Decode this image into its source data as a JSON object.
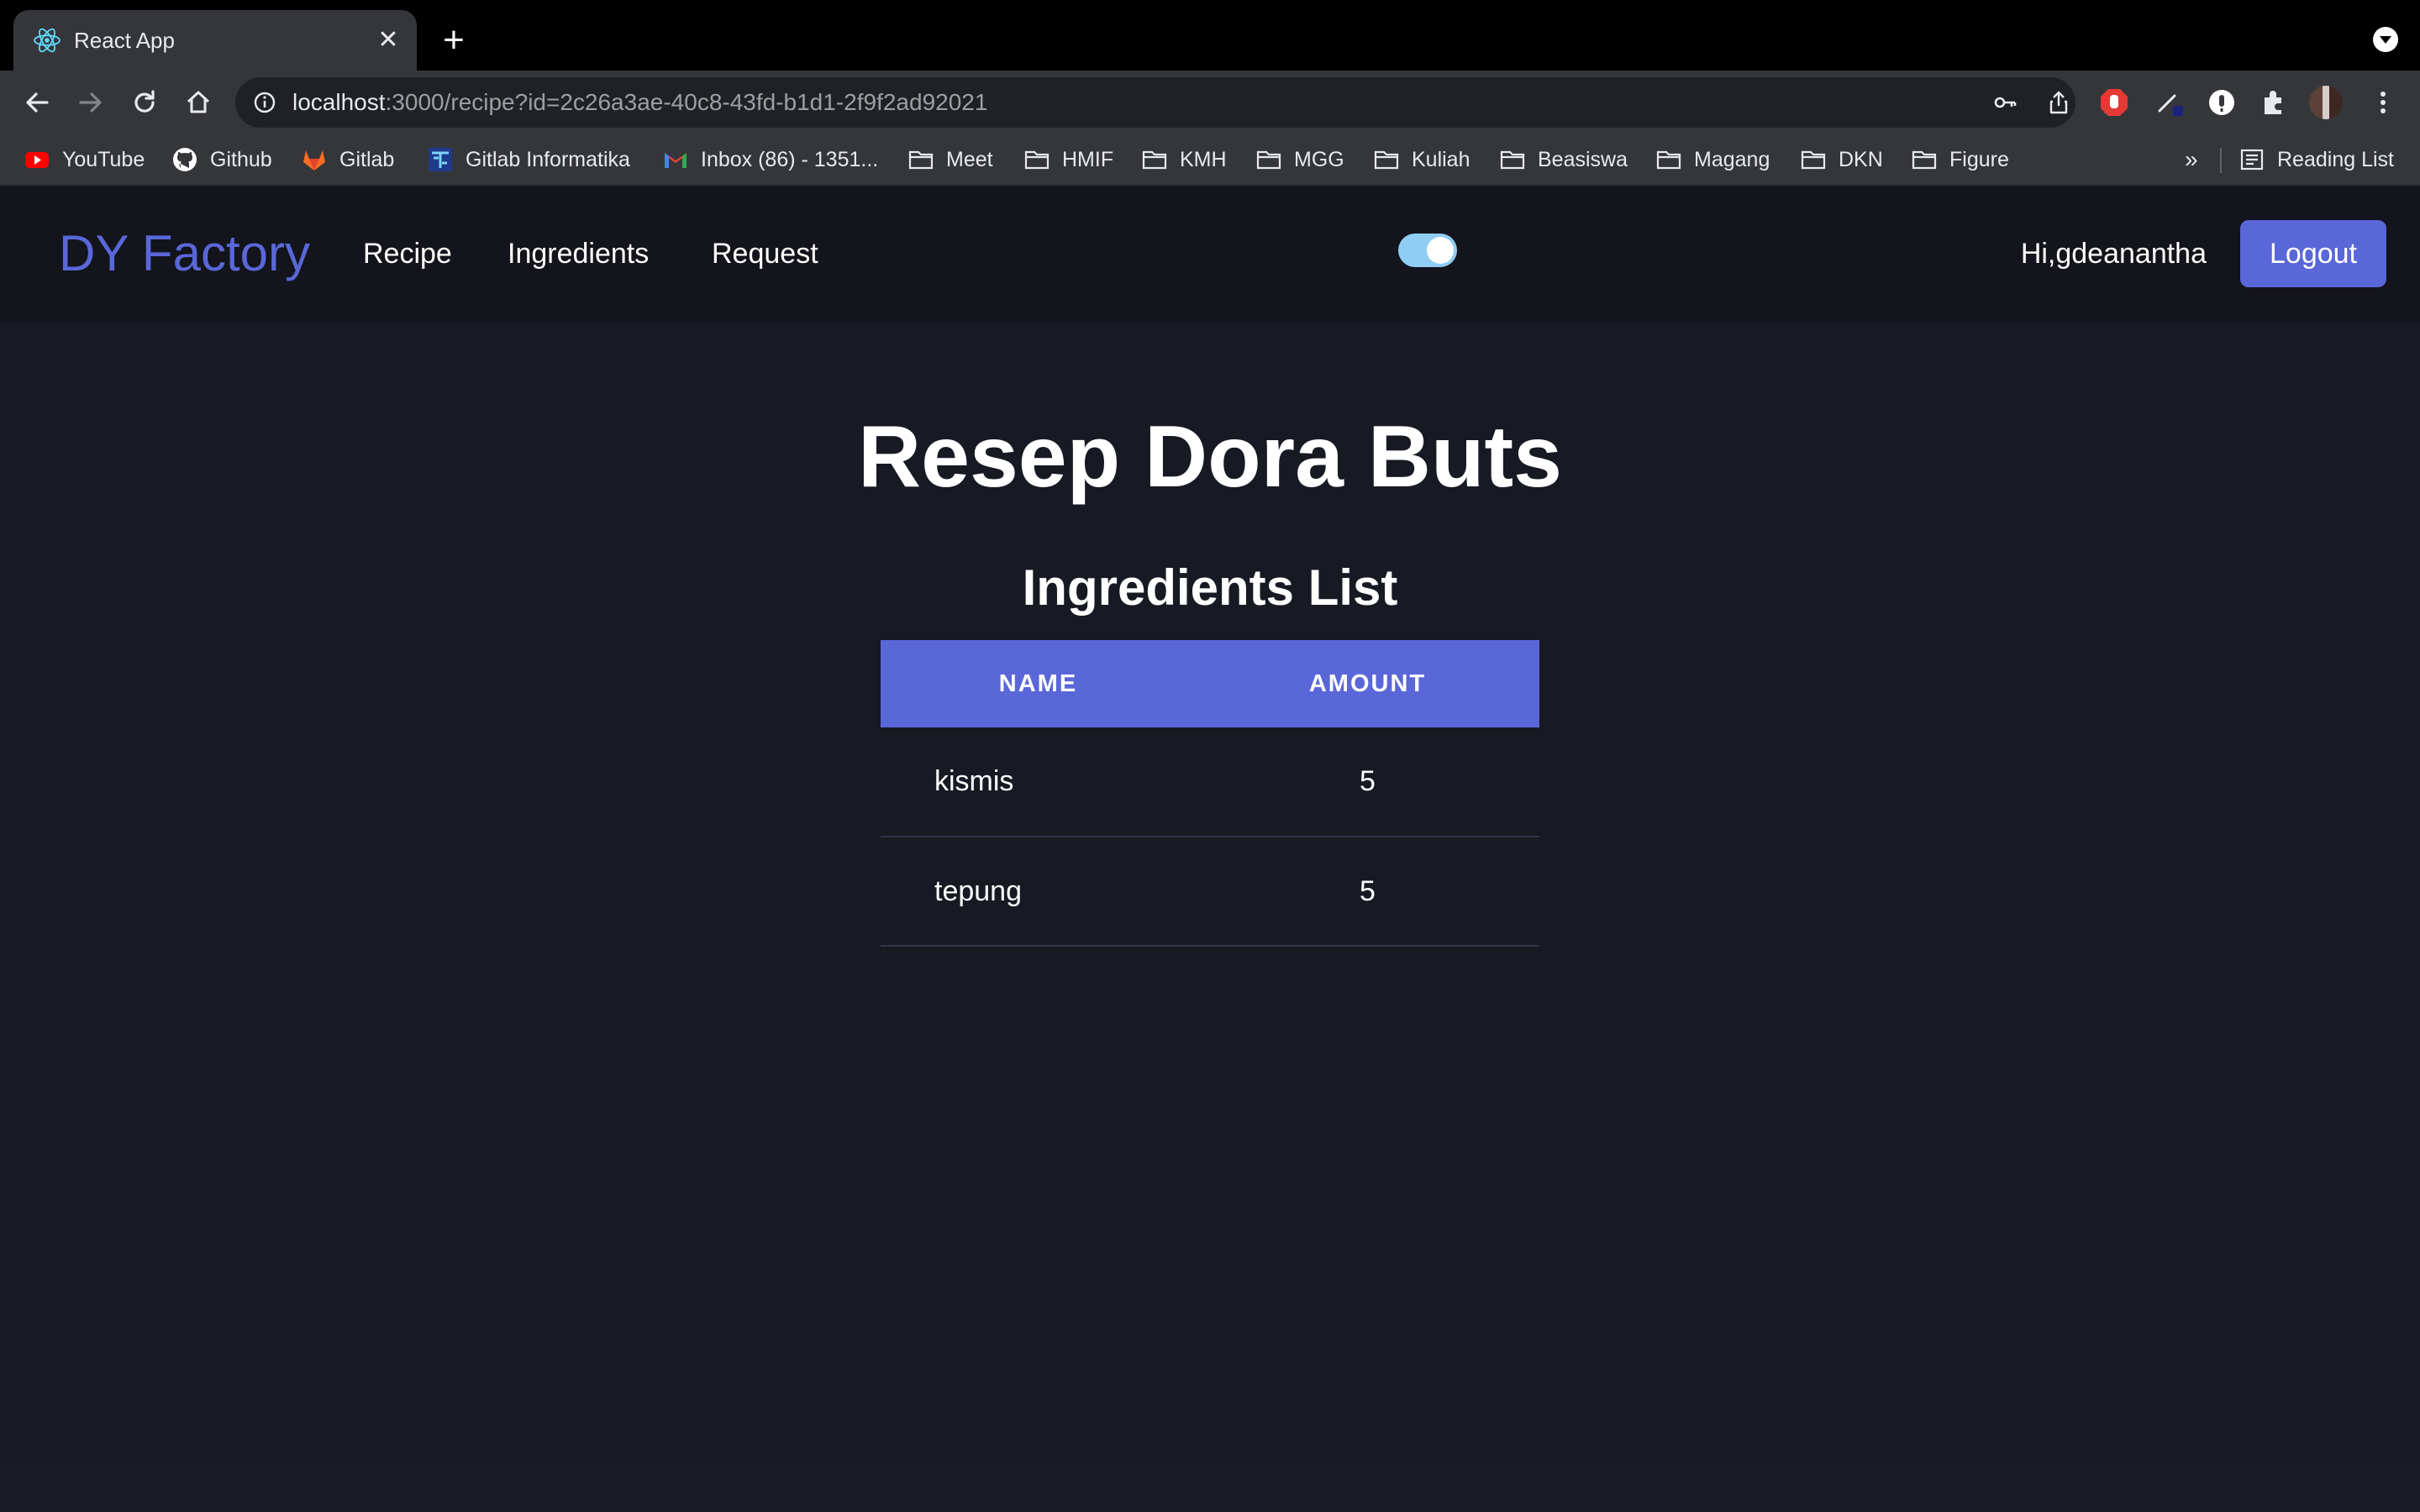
{
  "browser": {
    "tab": {
      "title": "React App",
      "close": "✕"
    },
    "new_tab": "+",
    "url": {
      "host": "localhost",
      "path": ":3000/recipe?id=2c26a3ae-40c8-43fd-b1d1-2f9f2ad92021"
    },
    "bookmarks": [
      {
        "label": "YouTube",
        "icon": "youtube-icon"
      },
      {
        "label": "Github",
        "icon": "github-icon"
      },
      {
        "label": "Gitlab",
        "icon": "gitlab-icon"
      },
      {
        "label": "Gitlab Informatika",
        "icon": "gitlab-informatika-icon"
      },
      {
        "label": "Inbox (86) - 1351...",
        "icon": "gmail-icon"
      },
      {
        "label": "Meet",
        "icon": "folder-icon"
      },
      {
        "label": "HMIF",
        "icon": "folder-icon"
      },
      {
        "label": "KMH",
        "icon": "folder-icon"
      },
      {
        "label": "MGG",
        "icon": "folder-icon"
      },
      {
        "label": "Kuliah",
        "icon": "folder-icon"
      },
      {
        "label": "Beasiswa",
        "icon": "folder-icon"
      },
      {
        "label": "Magang",
        "icon": "folder-icon"
      },
      {
        "label": "DKN",
        "icon": "folder-icon"
      },
      {
        "label": "Figure",
        "icon": "folder-icon"
      }
    ],
    "more": "»",
    "reading_list": "Reading List"
  },
  "app": {
    "brand": "DY Factory",
    "nav": {
      "recipe": "Recipe",
      "ingredients": "Ingredients",
      "request": "Request"
    },
    "theme_toggle_on": true,
    "greeting": "Hi,gdeanantha",
    "logout": "Logout",
    "colors": {
      "accent": "#5a67d8",
      "background": "#171923",
      "toggle": "#90cdf4"
    }
  },
  "recipe": {
    "title": "Resep Dora Buts",
    "list_title": "Ingredients List",
    "columns": {
      "name": "NAME",
      "amount": "AMOUNT"
    },
    "rows": [
      {
        "name": "kismis",
        "amount": "5"
      },
      {
        "name": "tepung",
        "amount": "5"
      }
    ]
  }
}
